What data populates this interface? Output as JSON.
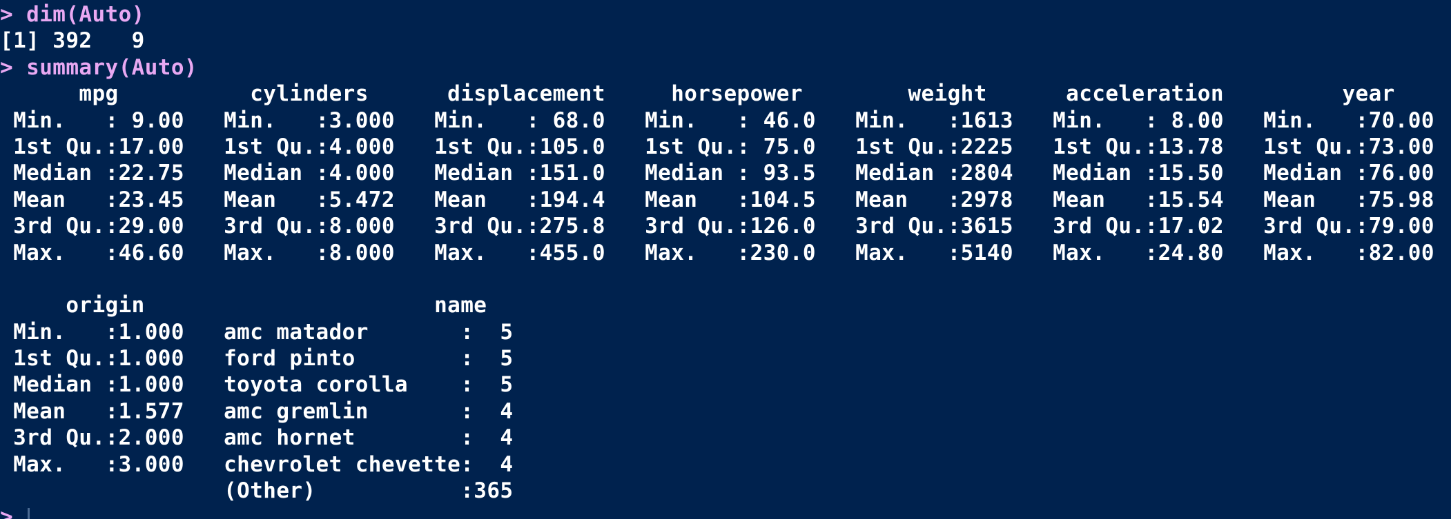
{
  "console": {
    "lines": [
      {
        "type": "cmd",
        "text": "> dim(Auto)"
      },
      {
        "type": "out",
        "text": "[1] 392   9"
      },
      {
        "type": "cmd",
        "text": "> summary(Auto)"
      },
      {
        "type": "out",
        "text": "      mpg          cylinders      displacement     horsepower        weight      acceleration         year    "
      },
      {
        "type": "out",
        "text": " Min.   : 9.00   Min.   :3.000   Min.   : 68.0   Min.   : 46.0   Min.   :1613   Min.   : 8.00   Min.   :70.00  "
      },
      {
        "type": "out",
        "text": " 1st Qu.:17.00   1st Qu.:4.000   1st Qu.:105.0   1st Qu.: 75.0   1st Qu.:2225   1st Qu.:13.78   1st Qu.:73.00  "
      },
      {
        "type": "out",
        "text": " Median :22.75   Median :4.000   Median :151.0   Median : 93.5   Median :2804   Median :15.50   Median :76.00  "
      },
      {
        "type": "out",
        "text": " Mean   :23.45   Mean   :5.472   Mean   :194.4   Mean   :104.5   Mean   :2978   Mean   :15.54   Mean   :75.98  "
      },
      {
        "type": "out",
        "text": " 3rd Qu.:29.00   3rd Qu.:8.000   3rd Qu.:275.8   3rd Qu.:126.0   3rd Qu.:3615   3rd Qu.:17.02   3rd Qu.:79.00  "
      },
      {
        "type": "out",
        "text": " Max.   :46.60   Max.   :8.000   Max.   :455.0   Max.   :230.0   Max.   :5140   Max.   :24.80   Max.   :82.00  "
      },
      {
        "type": "out",
        "text": ""
      },
      {
        "type": "out",
        "text": "     origin                      name    "
      },
      {
        "type": "out",
        "text": " Min.   :1.000   amc matador       :  5  "
      },
      {
        "type": "out",
        "text": " 1st Qu.:1.000   ford pinto        :  5  "
      },
      {
        "type": "out",
        "text": " Median :1.000   toyota corolla    :  5  "
      },
      {
        "type": "out",
        "text": " Mean   :1.577   amc gremlin       :  4  "
      },
      {
        "type": "out",
        "text": " 3rd Qu.:2.000   amc hornet        :  4  "
      },
      {
        "type": "out",
        "text": " Max.   :3.000   chevrolet chevette:  4  "
      },
      {
        "type": "out",
        "text": "                 (Other)           :365  "
      }
    ],
    "prompt": ">"
  },
  "colors": {
    "background": "#00224e",
    "output_text": "#ffffff",
    "command_text": "#e8a8f2"
  }
}
